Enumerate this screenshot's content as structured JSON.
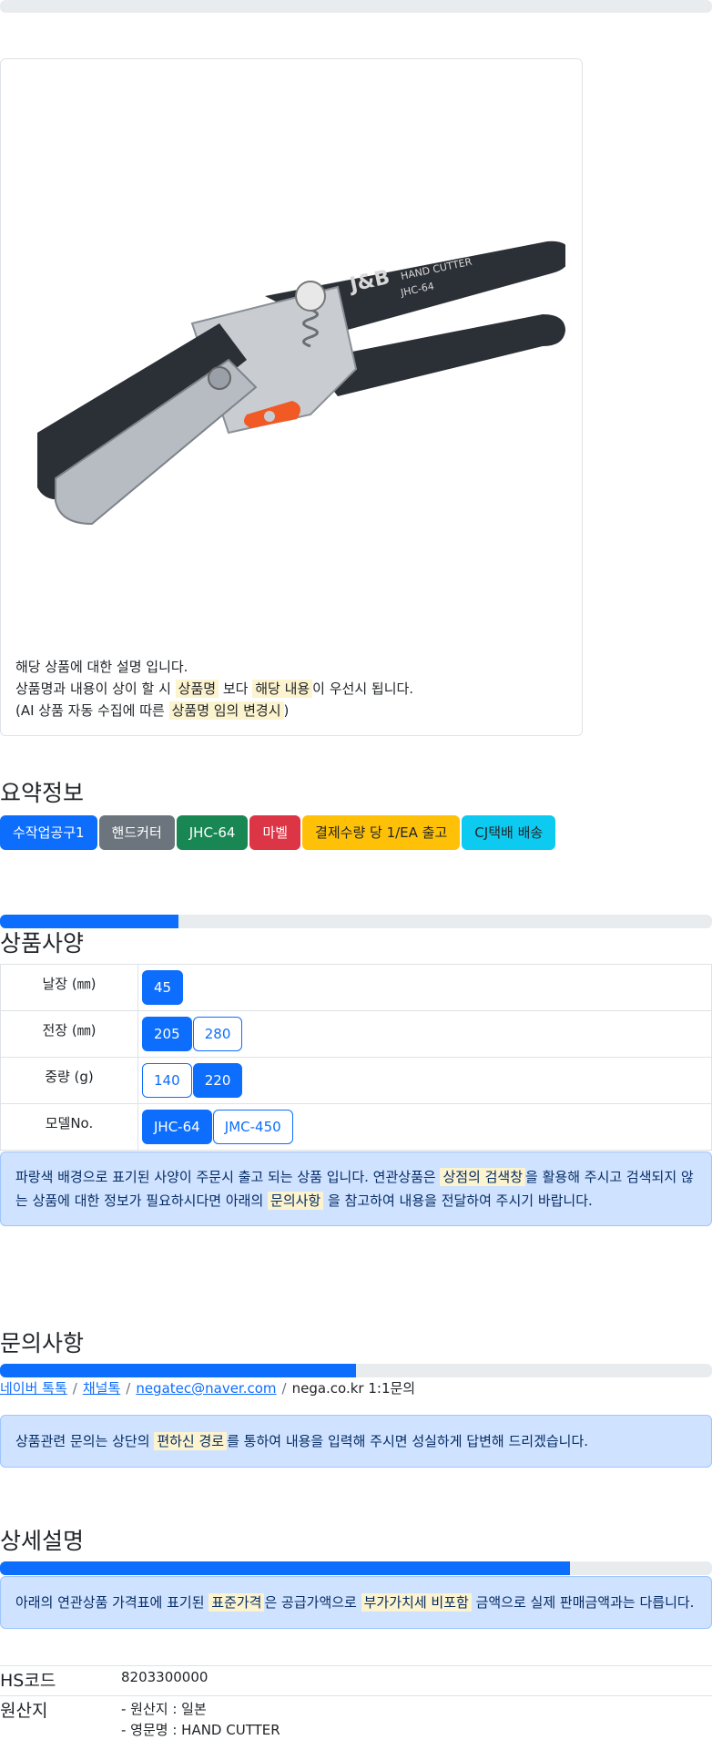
{
  "top_progress": {
    "value": 0
  },
  "product": {
    "image_alt": "HAND CUTTER JHC-64",
    "notice": {
      "line1": "해당 상품에 대한 설명 입니다.",
      "line2_a": "상품명과 내용이 상이 할 시 ",
      "line2_mark1": "상품명",
      "line2_b": " 보다 ",
      "line2_mark2": "해당 내용",
      "line2_c": "이 우선시 됩니다.",
      "line3_a": "(AI 상품 자동 수집에 따른 ",
      "line3_mark": "상품명 임의 변경시",
      "line3_b": ")"
    },
    "image_text": {
      "brand": "J&B",
      "name": "HAND CUTTER",
      "model": "JHC-64"
    }
  },
  "summary": {
    "title": "요약정보",
    "badges": [
      "수작업공구1",
      "핸드커터",
      "JHC-64",
      "마벨",
      "결제수량 당 1/EA 출고",
      "CJ택배 배송"
    ]
  },
  "specs": {
    "title": "상품사양",
    "progress": 0.25,
    "rows": [
      {
        "label": "날장 (㎜)",
        "options": [
          {
            "text": "45",
            "selected": true
          }
        ]
      },
      {
        "label": "전장 (㎜)",
        "options": [
          {
            "text": "205",
            "selected": true
          },
          {
            "text": "280",
            "selected": false
          }
        ]
      },
      {
        "label": "중량 (g)",
        "options": [
          {
            "text": "140",
            "selected": false
          },
          {
            "text": "220",
            "selected": true
          }
        ]
      },
      {
        "label": "모델No.",
        "options": [
          {
            "text": "JHC-64",
            "selected": true
          },
          {
            "text": "JMC-450",
            "selected": false
          }
        ]
      }
    ],
    "alert": {
      "a": "파랑색 배경으로 표기된 사양이 주문시 출고 되는 상품 입니다. 연관상품은 ",
      "mark1": "상점의 검색창",
      "b": "을 활용해 주시고 검색되지 않는 상품에 대한 정보가 필요하시다면 아래의 ",
      "mark2": "문의사항",
      "c": " 을 참고하여 내용을 전달하여 주시기 바랍니다."
    }
  },
  "inquiry": {
    "title": "문의사항",
    "progress": 0.5,
    "links": [
      "네이버 톡톡",
      "채널톡",
      "negatec@naver.com"
    ],
    "plain": "nega.co.kr 1:1문의",
    "alert": {
      "a": "상품관련 문의는 상단의 ",
      "mark": "편하신 경로",
      "b": "를 통하여 내용을 입력해 주시면 성실하게 답변해 드리겠습니다."
    }
  },
  "detail": {
    "title": "상세설명",
    "progress": 0.8,
    "alert": {
      "a": "아래의 연관상품 가격표에 표기된 ",
      "mark1": "표준가격",
      "b": "은 공급가액으로 ",
      "mark2": "부가가치세 비포함",
      "c": " 금액으로 실제 판매금액과는 다릅니다."
    },
    "hs_label": "HS코드",
    "hs_value": "8203300000",
    "origin_label": "원산지",
    "origin_lines": [
      "- 원산지 : 일본",
      "- 영문명 : HAND CUTTER"
    ]
  },
  "colors": {
    "primary": "#0d6efd",
    "secondary": "#6c757d",
    "success": "#198754",
    "danger": "#dc3545",
    "warning": "#ffc107",
    "info": "#0dcaf0"
  }
}
